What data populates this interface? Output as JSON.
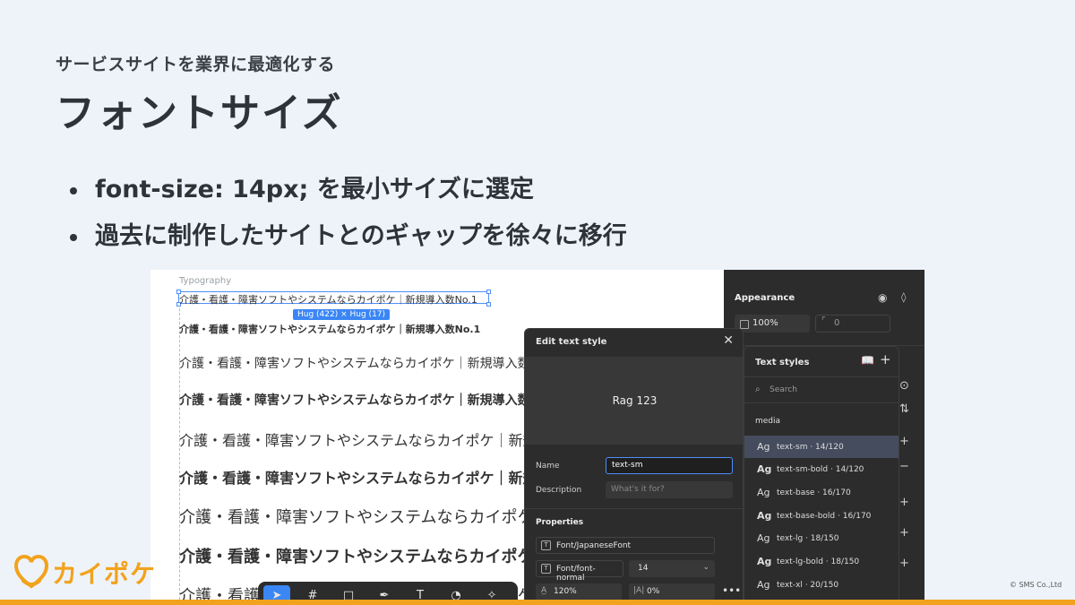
{
  "slide": {
    "eyebrow": "サービスサイトを業界に最適化する",
    "title": "フォントサイズ",
    "bullets": [
      "font-size: 14px; を最小サイズに選定",
      "過去に制作したサイトとのギャップを徐々に移行"
    ],
    "logo_text": "カイポケ",
    "copyright": "© SMS Co.,Ltd"
  },
  "canvas": {
    "frame_label": "Typography",
    "hug_badge": "Hug (422) × Hug (17)",
    "samples": [
      "介護・看護・障害ソフトやシステムならカイポケ｜新規導入数No.1",
      "介護・看護・障害ソフトやシステムならカイポケ｜新規導入数No.1",
      "介護・看護・障害ソフトやシステムならカイポケ｜新規導入数No.1",
      "介護・看護・障害ソフトやシステムならカイポケ｜新規導入数No.1",
      "介護・看護・障害ソフトやシステムならカイポケ｜新規導入数No.1",
      "介護・看護・障害ソフトやシステムならカイポケ｜新規導入数No.1",
      "介護・看護・障害ソフトやシステムならカイポケ｜新規導入数No.1",
      "介護・看護・障害ソフトやシステムならカイポケ｜新規導入数No.1",
      "介護・看護・障害ソフトやシステムならカイポケ｜新規導入数No.1"
    ]
  },
  "toolbar": {
    "tools": [
      "move-tool",
      "frame-tool",
      "shape-tool",
      "pen-tool",
      "text-tool",
      "comment-tool",
      "actions-tool"
    ]
  },
  "appearance": {
    "heading": "Appearance",
    "opacity": "100%",
    "radius": "0"
  },
  "edit_style": {
    "title": "Edit text style",
    "preview": "Rag 123",
    "name_label": "Name",
    "name_value": "text-sm",
    "description_label": "Description",
    "description_placeholder": "What's it for?",
    "properties_label": "Properties",
    "font_family": "Font/JapaneseFont",
    "font_weight": "Font/font-normal",
    "font_size": "14",
    "line_height": "120%",
    "letter_spacing": "0%"
  },
  "text_styles": {
    "title": "Text styles",
    "search_placeholder": "Search",
    "group": "media",
    "items": [
      {
        "ag": "Ag",
        "name": "text-sm · 14/120"
      },
      {
        "ag": "Ag",
        "name": "text-sm-bold · 14/120"
      },
      {
        "ag": "Ag",
        "name": "text-base · 16/170"
      },
      {
        "ag": "Ag",
        "name": "text-base-bold · 16/170"
      },
      {
        "ag": "Ag",
        "name": "text-lg · 18/150"
      },
      {
        "ag": "Ag",
        "name": "text-lg-bold · 18/150"
      },
      {
        "ag": "Ag",
        "name": "text-xl · 20/150"
      }
    ]
  },
  "colors": {
    "accent": "#3a86f5",
    "brand_orange": "#f2a21c",
    "panel_dark": "#2c2c2c"
  }
}
